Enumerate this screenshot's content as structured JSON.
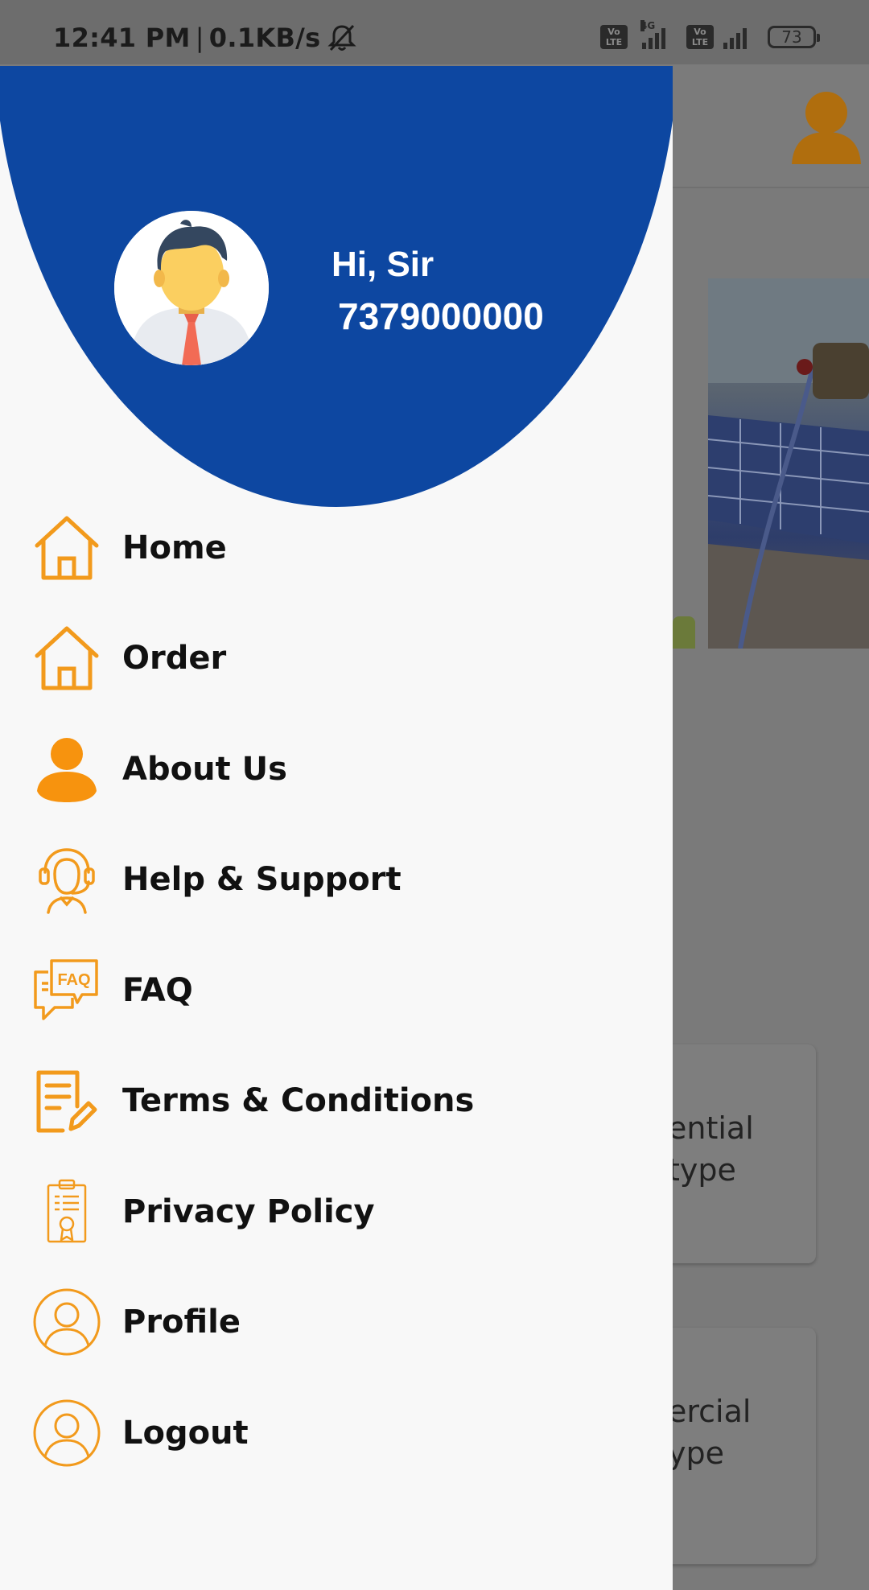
{
  "status_bar": {
    "time": "12:41 PM",
    "speed": "0.1KB/s",
    "network_tag": "4G",
    "volte_label": "Vo LTE",
    "battery": "73"
  },
  "drawer": {
    "greeting": "Hi, Sir",
    "phone": "7379000000",
    "accent_color": "#0d47a1",
    "icon_color": "#f29a1c",
    "menu": [
      {
        "label": "Home",
        "icon": "home-icon"
      },
      {
        "label": "Order",
        "icon": "home-icon"
      },
      {
        "label": "About Us",
        "icon": "person-icon"
      },
      {
        "label": "Help & Support",
        "icon": "headset-icon"
      },
      {
        "label": "FAQ",
        "icon": "faq-icon"
      },
      {
        "label": "Terms & Conditions",
        "icon": "document-edit-icon"
      },
      {
        "label": "Privacy Policy",
        "icon": "clipboard-icon"
      },
      {
        "label": "Profile",
        "icon": "user-circle-icon"
      },
      {
        "label": "Logout",
        "icon": "user-circle-icon"
      }
    ]
  },
  "background": {
    "card1_line1": "ential",
    "card1_line2": "type",
    "card2_line1": "ercial",
    "card2_line2": "ype"
  }
}
